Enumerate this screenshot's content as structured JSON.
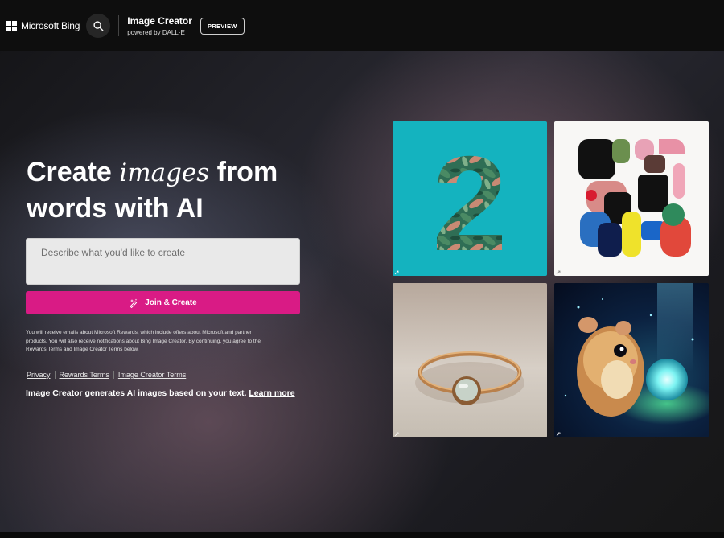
{
  "header": {
    "brand": "Microsoft Bing",
    "product_title": "Image Creator",
    "product_subtitle": "powered by DALL·E",
    "badge": "PREVIEW"
  },
  "hero": {
    "title_part1": "Create ",
    "title_emphasis": "images",
    "title_part2": " from words with AI"
  },
  "prompt": {
    "placeholder": "Describe what you'd like to create"
  },
  "join_button": {
    "label": "Join & Create"
  },
  "legal_text": "You will receive emails about Microsoft Rewards, which include offers about Microsoft and partner products. You will also receive notifications about Bing Image Creator. By continuing, you agree to the Rewards Terms and Image Creator Terms below.",
  "links": {
    "privacy": "Privacy",
    "rewards_terms": "Rewards Terms",
    "image_creator_terms": "Image Creator Terms"
  },
  "footer_note": {
    "text": "Image Creator generates AI images based on your text. ",
    "link": "Learn more"
  },
  "gallery": {
    "images": [
      "number-two-leaves-image",
      "abstract-shapes-image",
      "gold-ring-image",
      "glowing-hamster-image"
    ]
  },
  "colors": {
    "accent": "#d91b85",
    "topbar": "#0e0e0e",
    "tile_teal": "#14b3bf"
  }
}
